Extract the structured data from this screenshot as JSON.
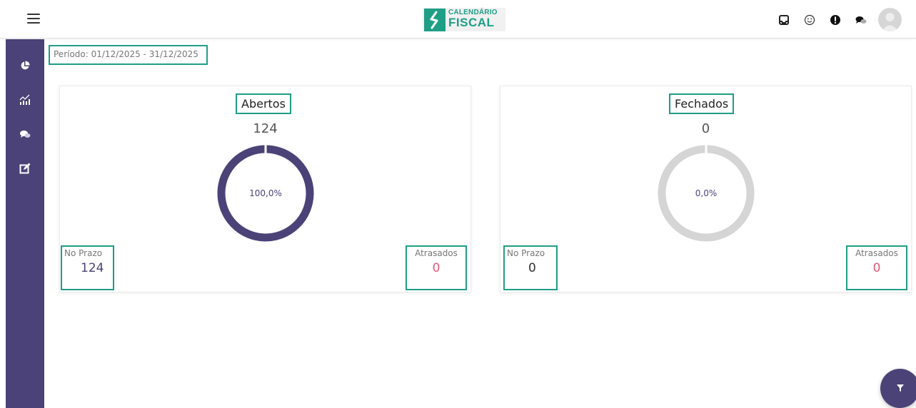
{
  "header": {
    "logo_line1": "CALENDÁRIO",
    "logo_line2": "FISCAL",
    "icons": [
      "inbox-icon",
      "smiley-icon",
      "alert-icon",
      "chat-icon",
      "avatar"
    ]
  },
  "sidebar": {
    "items": [
      "pie-chart-icon",
      "bar-chart-icon",
      "chat-bubbles-icon",
      "edit-icon"
    ]
  },
  "period": "Período: 01/12/2025 - 31/12/2025",
  "cards": [
    {
      "title": "Abertos",
      "total": "124",
      "percent_label": "100,0%",
      "percent": 100,
      "ring_color": "#4b4277",
      "no_prazo_label": "No Prazo",
      "no_prazo_value": "124",
      "atrasados_label": "Atrasados",
      "atrasados_value": "0"
    },
    {
      "title": "Fechados",
      "total": "0",
      "percent_label": "0,0%",
      "percent": 0,
      "ring_color": "#d5d5d5",
      "no_prazo_label": "No Prazo",
      "no_prazo_value": "0",
      "atrasados_label": "Atrasados",
      "atrasados_value": "0"
    }
  ],
  "colors": {
    "accent": "#1f9e86",
    "sidebar": "#4b4277",
    "late": "#e05a78",
    "ontime": "#4b4277"
  },
  "fab_icon": "filter-icon"
}
